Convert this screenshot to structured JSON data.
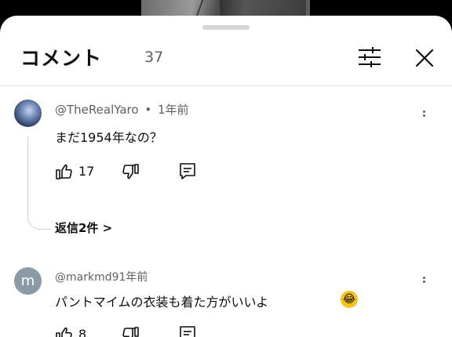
{
  "header": {
    "title": "コメント",
    "count": "37"
  },
  "comments": [
    {
      "author": "@TheRealYaro",
      "separator": "•",
      "time": "1年前",
      "text": "まだ1954年なの？",
      "likes": "17",
      "replies_label": "返信2件 >"
    },
    {
      "avatar_letter": "m",
      "author_time": "@markmd91年前",
      "text": "パントマイムの衣装も着た方がいいよ",
      "emoji": "😂",
      "likes": "8"
    }
  ],
  "icons": {
    "filter": "sliders-icon",
    "close": "close-icon",
    "like": "thumbs-up-icon",
    "dislike": "thumbs-down-icon",
    "reply": "comment-reply-icon",
    "more": "more-vertical-icon"
  }
}
